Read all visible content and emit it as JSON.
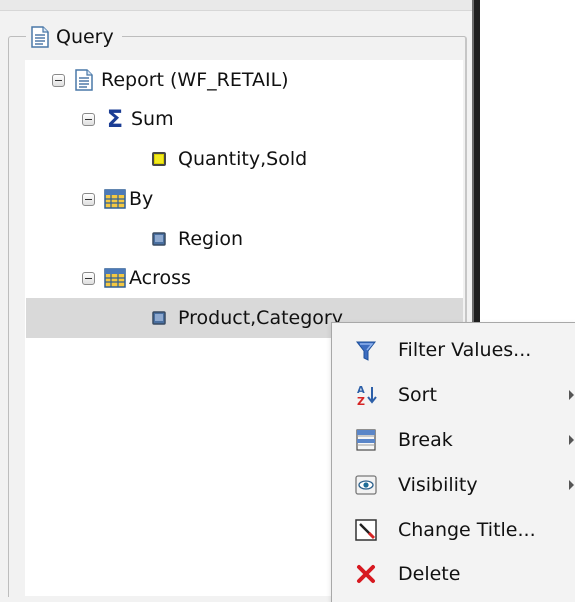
{
  "panel": {
    "legend_icon": "document-icon",
    "legend": "Query"
  },
  "tree": {
    "root": {
      "label": "Report (WF_RETAIL)",
      "icon": "document-icon"
    },
    "sum": {
      "label": "Sum",
      "icon": "sigma-icon",
      "children": [
        {
          "label": "Quantity,Sold",
          "icon": "measure-field-icon"
        }
      ]
    },
    "by": {
      "label": "By",
      "icon": "grid-icon",
      "children": [
        {
          "label": "Region",
          "icon": "dimension-field-icon"
        }
      ]
    },
    "across": {
      "label": "Across",
      "icon": "grid-icon",
      "children": [
        {
          "label": "Product,Category",
          "icon": "dimension-field-icon"
        }
      ]
    }
  },
  "context_menu": {
    "items": [
      {
        "label": "Filter Values...",
        "icon": "filter-icon"
      },
      {
        "label": "Sort",
        "icon": "sort-az-icon",
        "submenu": true
      },
      {
        "label": "Break",
        "icon": "break-icon",
        "submenu": true
      },
      {
        "label": "Visibility",
        "icon": "visibility-icon",
        "submenu": true
      },
      {
        "label": "Change Title...",
        "icon": "change-title-icon"
      },
      {
        "label": "Delete",
        "icon": "delete-icon"
      }
    ]
  },
  "colors": {
    "highlight": "#d9d9d9",
    "menu_background": "#f3f3f3",
    "sigma_blue": "#1b3d94",
    "delete_red": "#d71920"
  }
}
